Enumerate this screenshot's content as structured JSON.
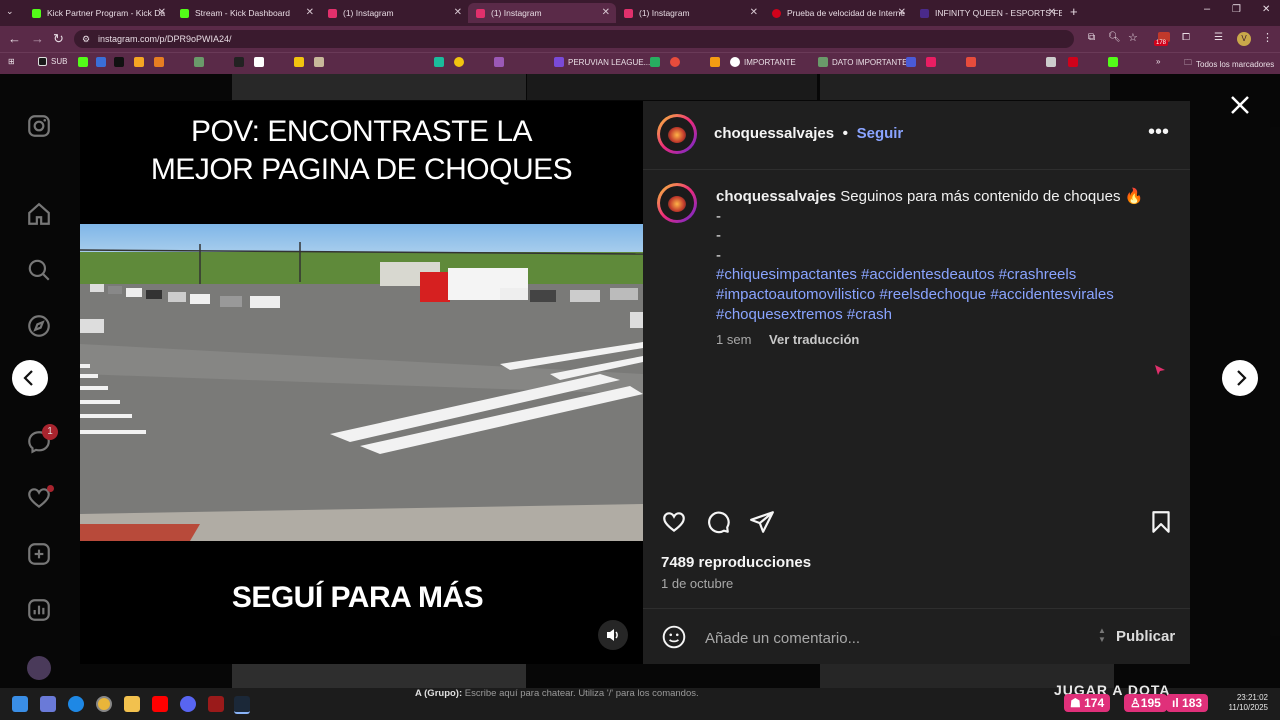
{
  "browser": {
    "tabs": [
      {
        "title": "Kick Partner Program - Kick Da",
        "color": "#53fc18"
      },
      {
        "title": "Stream - Kick Dashboard",
        "color": "#53fc18"
      },
      {
        "title": "(1) Instagram",
        "color": "#e1306c"
      },
      {
        "title": "(1) Instagram",
        "color": "#e1306c",
        "active": true
      },
      {
        "title": "(1) Instagram",
        "color": "#e1306c"
      },
      {
        "title": "Prueba de velocidad de Interne",
        "color": "#d0021b"
      },
      {
        "title": "INFINITY QUEEN - ESPORTS FE",
        "color": "#4a2a8a"
      }
    ],
    "url": "instagram.com/p/DPR9oPWIA24/",
    "bookmarks": [
      "SUB",
      "PERUVIAN LEAGUE...",
      "IMPORTANTE",
      "DATO IMPORTANTE"
    ],
    "all_bookmarks": "Todos los marcadores",
    "ext_badge": "178"
  },
  "sidebar": {
    "messages_badge": "1"
  },
  "post": {
    "headline_line1": "POV: ENCONTRASTE LA",
    "headline_line2": "MEJOR PAGINA DE CHOQUES",
    "footer_text": "SEGUÍ PARA MÁS",
    "username": "choquessalvajes",
    "follow_label": "Seguir",
    "separator": "•",
    "caption_username": "choquessalvajes",
    "caption_text": "Seguinos para más contenido de choques 🔥",
    "caption_dashes": [
      "-",
      "-",
      "-"
    ],
    "hashtags_line1": "#chiquesimpactantes #accidentesdeautos #crashreels",
    "hashtags_line2": "#impactoautomovilistico #reelsdechoque #accidentesvirales",
    "hashtags_line3": "#choquesextremos #crash",
    "time_ago": "1 sem",
    "translate_label": "Ver traducción",
    "views": "7489 reproducciones",
    "date": "1 de octubre",
    "comment_placeholder": "Añade un comentario...",
    "publish_label": "Publicar"
  },
  "taskbar": {
    "chat_prefix": "A (Grupo):",
    "chat_text": "Escribe aquí para chatear. Utiliza '/' para los comandos.",
    "game_banner": "JUGAR A DOTA",
    "stat1": "174",
    "stat2": "195",
    "stat3": "183",
    "time": "23:21:02",
    "date": "11/10/2025"
  },
  "colors": {
    "accent_link": "#8aa4ff",
    "panel_bg": "#1f1f1f",
    "notification_red": "#ff3040"
  }
}
